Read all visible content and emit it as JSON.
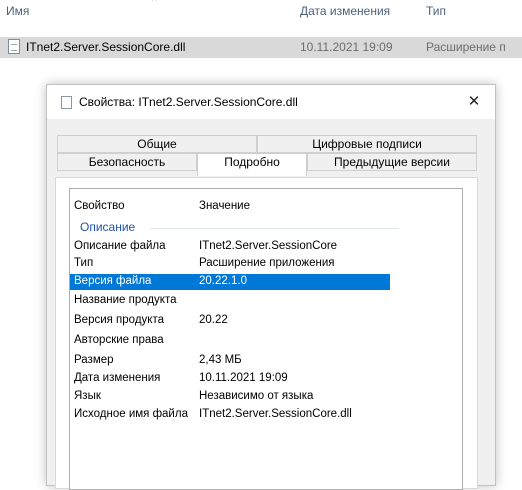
{
  "explorer": {
    "columns": {
      "name": "Имя",
      "modified": "Дата изменения",
      "type": "Тип"
    },
    "sort_indicator": "^",
    "file": {
      "name": "ITnet2.Server.SessionCore.dll",
      "modified": "10.11.2021 19:09",
      "type": "Расширение п"
    }
  },
  "dialog": {
    "title": "Свойства: ITnet2.Server.SessionCore.dll",
    "close_glyph": "✕",
    "tabs_top": [
      "Общие",
      "Цифровые подписи"
    ],
    "tabs_bottom": [
      "Безопасность",
      "Подробно",
      "Предыдущие версии"
    ],
    "active_tab": "Подробно",
    "details": {
      "col_property": "Свойство",
      "col_value": "Значение",
      "group": "Описание",
      "rows": [
        {
          "key": "Описание файла",
          "value": "ITnet2.Server.SessionCore"
        },
        {
          "key": "Тип",
          "value": "Расширение приложения"
        },
        {
          "key": "Версия файла",
          "value": "20.22.1.0"
        },
        {
          "key": "Название продукта",
          "value": ""
        },
        {
          "key": "Версия продукта",
          "value": "20.22"
        },
        {
          "key": "Авторские права",
          "value": ""
        },
        {
          "key": "Размер",
          "value": "2,43 МБ"
        },
        {
          "key": "Дата изменения",
          "value": "10.11.2021 19:09"
        },
        {
          "key": "Язык",
          "value": "Независимо от языка"
        },
        {
          "key": "Исходное имя файла",
          "value": "ITnet2.Server.SessionCore.dll"
        }
      ],
      "selected_row": "Версия файла"
    }
  },
  "colors": {
    "selection": "#0078d7",
    "group_label": "#1f52b0",
    "file_row_bg": "#d9d9d9",
    "header_text": "#4c607a"
  }
}
